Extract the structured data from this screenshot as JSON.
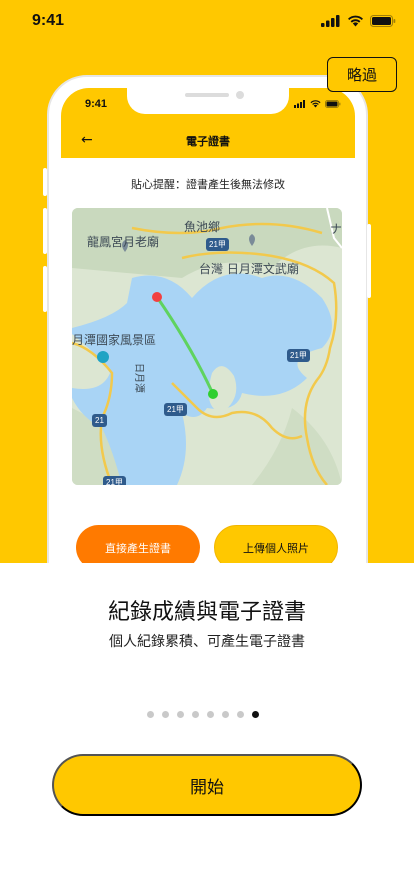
{
  "status_bar": {
    "time": "9:41"
  },
  "skip_label": "略過",
  "mockup": {
    "time": "9:41",
    "title": "電子證書",
    "notice": "貼心提醒：證書產生後無法修改",
    "map": {
      "labels": {
        "fish_pond": "魚池鄉",
        "longfeng": "龍鳳宮月老廟",
        "wenwu": "台灣 日月潭文武廟",
        "scenic_area": "月潭國家風景區",
        "lake_name": "日月潭",
        "corner_mark": "ナ"
      },
      "road_shields": [
        "21甲",
        "21甲",
        "21甲",
        "21",
        "21甲"
      ],
      "colors": {
        "water": "#A9D4F5",
        "land": "#DCE6D2",
        "road": "#F2C94C",
        "route": "#5FD35F",
        "start": "#F24040",
        "end": "#2FCF2F"
      }
    },
    "buttons": {
      "direct": "直接產生證書",
      "upload": "上傳個人照片"
    }
  },
  "headline": "紀錄成績與電子證書",
  "subline": "個人紀錄累積、可產生電子證書",
  "pagination": {
    "total": 8,
    "current": 8
  },
  "start_label": "開始",
  "colors": {
    "brand_yellow": "#FFC800",
    "accent_orange": "#FF7A00"
  }
}
